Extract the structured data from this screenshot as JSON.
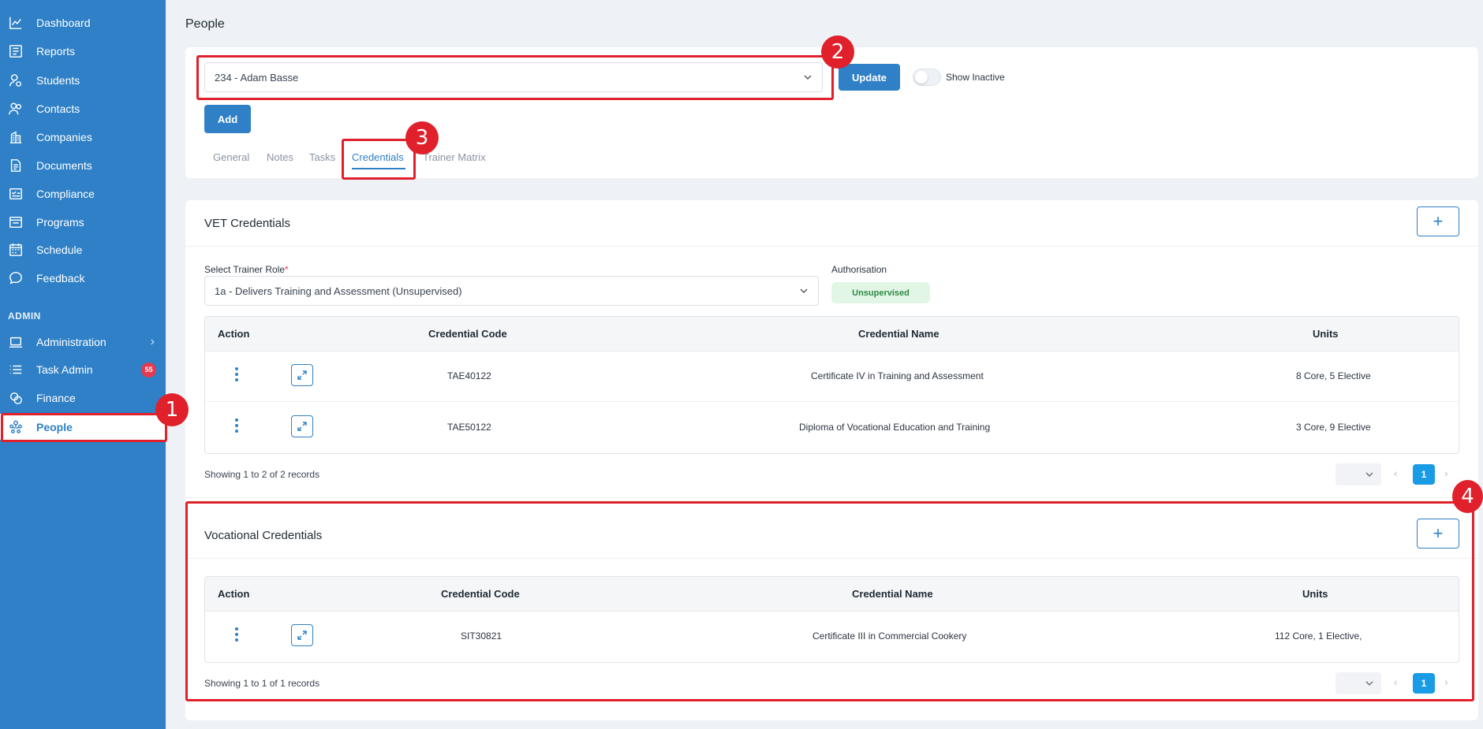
{
  "sidebar": {
    "items": [
      {
        "label": "Dashboard",
        "icon": "chart-line-icon"
      },
      {
        "label": "Reports",
        "icon": "report-icon"
      },
      {
        "label": "Students",
        "icon": "student-icon"
      },
      {
        "label": "Contacts",
        "icon": "contacts-icon"
      },
      {
        "label": "Companies",
        "icon": "building-icon"
      },
      {
        "label": "Documents",
        "icon": "document-icon"
      },
      {
        "label": "Compliance",
        "icon": "checklist-icon"
      },
      {
        "label": "Programs",
        "icon": "programs-icon"
      },
      {
        "label": "Schedule",
        "icon": "calendar-icon"
      },
      {
        "label": "Feedback",
        "icon": "chat-icon"
      }
    ],
    "admin_heading": "ADMIN",
    "admin_items": [
      {
        "label": "Administration",
        "icon": "laptop-icon"
      },
      {
        "label": "Task Admin",
        "icon": "list-icon",
        "badge": "55"
      },
      {
        "label": "Finance",
        "icon": "coins-icon"
      },
      {
        "label": "People",
        "icon": "people-icon"
      }
    ]
  },
  "page": {
    "title": "People",
    "person_select": "234 - Adam Basse",
    "update_label": "Update",
    "show_inactive_label": "Show Inactive",
    "add_label": "Add",
    "tabs": [
      "General",
      "Notes",
      "Tasks",
      "Credentials",
      "Trainer Matrix"
    ],
    "active_tab": "Credentials"
  },
  "vet": {
    "title": "VET Credentials",
    "plus": "+",
    "role_label": "Select Trainer Role",
    "role_required": "*",
    "role_value": "1a - Delivers Training and Assessment (Unsupervised)",
    "auth_label": "Authorisation",
    "auth_value": "Unsupervised",
    "columns": [
      "Action",
      "Credential Code",
      "Credential Name",
      "Units"
    ],
    "rows": [
      {
        "code": "TAE40122",
        "name": "Certificate IV in Training and Assessment",
        "units": "8 Core, 5 Elective"
      },
      {
        "code": "TAE50122",
        "name": "Diploma of Vocational Education and Training",
        "units": "3 Core, 9 Elective"
      }
    ],
    "showing": "Showing 1 to 2 of 2 records",
    "page": "1",
    "prev": "‹",
    "next": "›"
  },
  "vocational": {
    "title": "Vocational Credentials",
    "plus": "+",
    "columns": [
      "Action",
      "Credential Code",
      "Credential Name",
      "Units"
    ],
    "rows": [
      {
        "code": "SIT30821",
        "name": "Certificate III in Commercial Cookery",
        "units": "112 Core, 1 Elective,"
      }
    ],
    "showing": "Showing 1 to 1 of 1 records",
    "page": "1",
    "prev": "‹",
    "next": "›"
  },
  "annotations": [
    "1",
    "2",
    "3",
    "4"
  ],
  "colors": {
    "sidebar": "#2f80c6",
    "accent": "#2f80c6",
    "highlight": "#e0202b",
    "badge": "#e53950",
    "page_active": "#1a9be6"
  }
}
